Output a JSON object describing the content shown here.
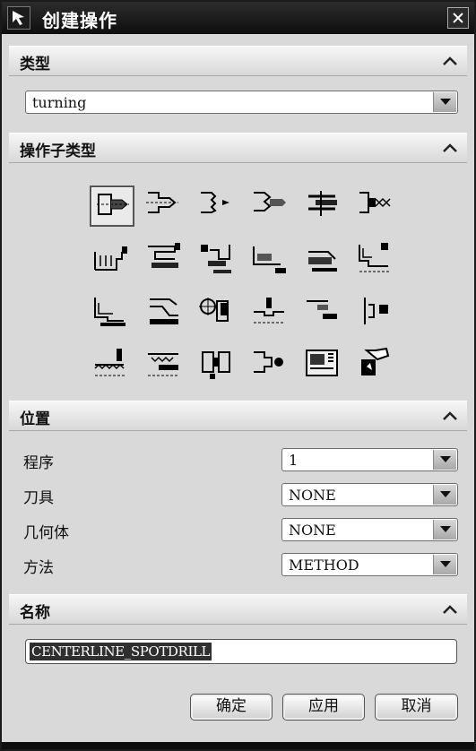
{
  "window": {
    "title": "创建操作"
  },
  "sections": {
    "type": {
      "label": "类型",
      "combo_value": "turning"
    },
    "subtype": {
      "label": "操作子类型"
    },
    "location": {
      "label": "位置",
      "fields": [
        {
          "label": "程序",
          "value": "1"
        },
        {
          "label": "刀具",
          "value": "NONE"
        },
        {
          "label": "几何体",
          "value": "NONE"
        },
        {
          "label": "方法",
          "value": "METHOD"
        }
      ]
    },
    "name": {
      "label": "名称",
      "value": "CENTERLINE_SPOTDRILL"
    }
  },
  "subtype_icons": [
    "centerline-spotdrill-icon",
    "centerline-drilling-icon",
    "centerline-peck-drill-icon",
    "centerline-break-chip-icon",
    "centerline-reaming-icon",
    "centerline-tapping-icon",
    "facing-icon",
    "rough-turn-od-icon",
    "rough-back-turn-icon",
    "rough-bore-id-icon",
    "rough-back-bore-icon",
    "finish-turn-od-icon",
    "finish-bore-id-icon",
    "finish-back-bore-icon",
    "teach-mode-icon",
    "groove-od-icon",
    "groove-id-icon",
    "groove-face-icon",
    "thread-od-icon",
    "thread-id-icon",
    "partoff-icon",
    "centerline-user-icon",
    "lathe-control-icon",
    "lathe-user-icon"
  ],
  "buttons": {
    "ok": "确定",
    "apply": "应用",
    "cancel": "取消"
  }
}
